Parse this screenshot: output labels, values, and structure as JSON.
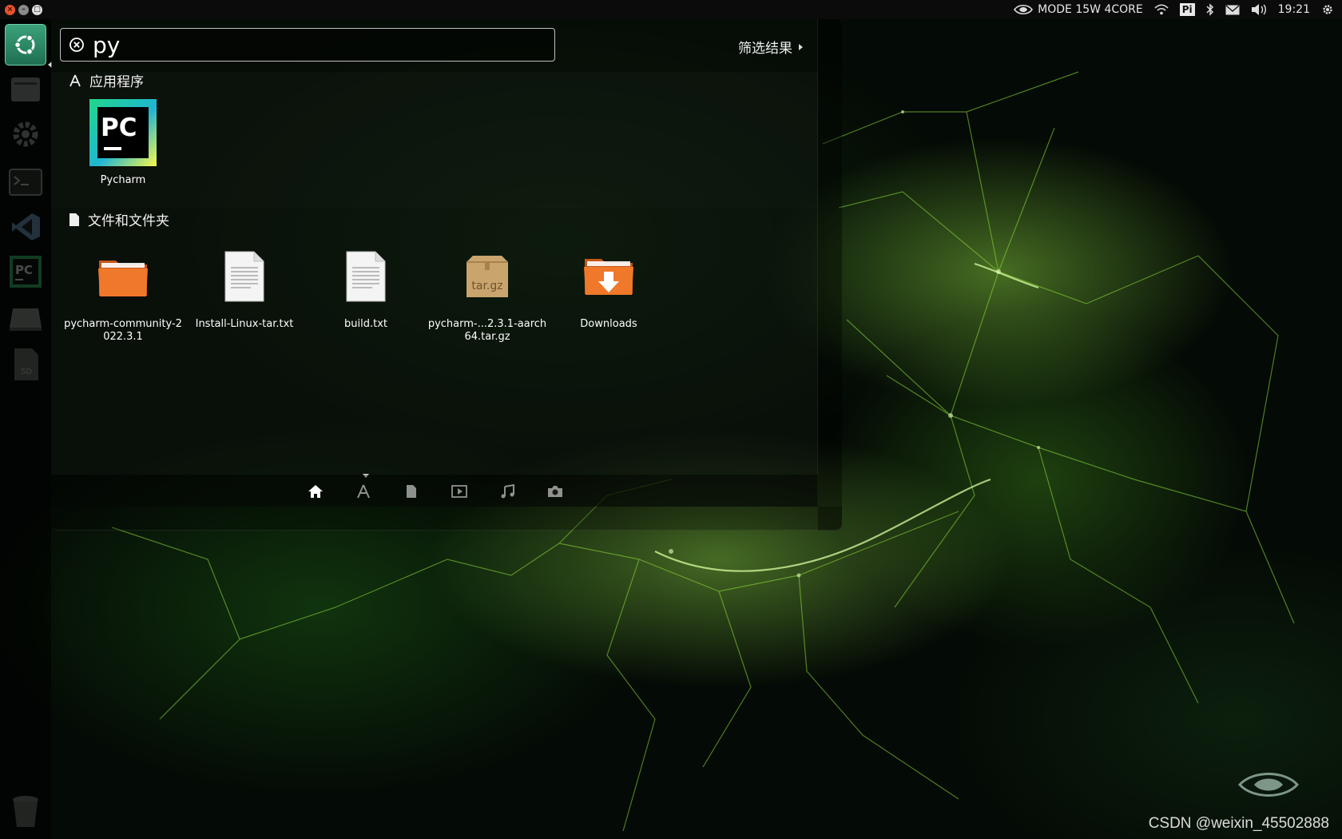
{
  "top_panel": {
    "power_mode": "MODE 15W 4CORE",
    "keyboard_indicator": "Pi",
    "clock": "19:21",
    "icons": [
      "nvidia-icon",
      "wifi-icon",
      "bluetooth-icon",
      "mail-icon",
      "volume-icon",
      "gear-icon"
    ]
  },
  "window_controls": {
    "close": "×",
    "minimize": "–",
    "maximize": "□"
  },
  "launcher": {
    "items": [
      {
        "name": "ubuntu-dash-icon",
        "active": true
      },
      {
        "name": "file-manager-icon",
        "active": false
      },
      {
        "name": "settings-icon",
        "active": false
      },
      {
        "name": "terminal-icon",
        "active": false
      },
      {
        "name": "vscode-icon",
        "active": false
      },
      {
        "name": "pycharm-icon",
        "active": false
      },
      {
        "name": "drive-icon",
        "active": false
      },
      {
        "name": "sd-card-icon",
        "active": false,
        "label": "SD"
      },
      {
        "name": "trash-icon",
        "active": false
      }
    ]
  },
  "dash": {
    "search_value": "py",
    "filter_label": "筛选结果",
    "sections": {
      "applications": {
        "title": "应用程序",
        "items": [
          {
            "label": "Pycharm",
            "icon": "pycharm-app-icon",
            "icon_text": "PC"
          }
        ]
      },
      "files": {
        "title": "文件和文件夹",
        "items": [
          {
            "label": "pycharm-community-2022.3.1",
            "icon": "folder-icon"
          },
          {
            "label": "Install-Linux-tar.txt",
            "icon": "text-file-icon"
          },
          {
            "label": "build.txt",
            "icon": "text-file-icon"
          },
          {
            "label": "pycharm-...2.3.1-aarch64.tar.gz",
            "icon": "archive-icon",
            "icon_text": "tar.gz"
          },
          {
            "label": "Downloads",
            "icon": "downloads-folder-icon"
          }
        ]
      }
    },
    "lenses": [
      "home-lens-icon",
      "applications-lens-icon",
      "files-lens-icon",
      "video-lens-icon",
      "music-lens-icon",
      "photo-lens-icon"
    ]
  },
  "watermark": "CSDN @weixin_45502888",
  "colors": {
    "accent_green": "#76b900",
    "folder_orange": "#f0782a"
  }
}
